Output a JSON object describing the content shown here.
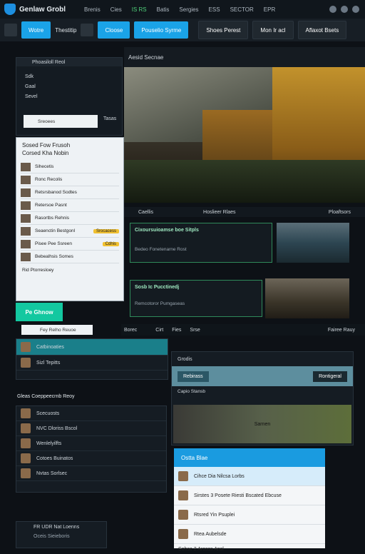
{
  "app": {
    "title": "Genlaw Grobl"
  },
  "menu": [
    "Brenis",
    "Cies",
    "IS RS",
    "Batis",
    "Sergies",
    "ESS",
    "SECTOR",
    "EPR"
  ],
  "toolbar": {
    "btn1": "Wotre",
    "label1": "Thestitip",
    "btn2": "Cloose",
    "btn3": "Pouselio Syrme",
    "field1": "Shoes Perest",
    "field2": "Mon Ir acl",
    "field3": "Aflaxot Bsets"
  },
  "left_panel": {
    "header": "Phoasiloll Reol",
    "items": [
      "Sdk",
      "Gaal",
      "Sevel"
    ],
    "search_label": "Sreoees",
    "search_btn": "Tasas"
  },
  "hero": {
    "caption": "Aesid Secnae"
  },
  "dialog": {
    "title": "Sosed Fow Frusoh",
    "subtitle": "Corsed Kha Nobin",
    "rows": [
      {
        "text": "Sihecetis",
        "btn": ""
      },
      {
        "text": "Ronc Recolis",
        "btn": ""
      },
      {
        "text": "Retsrsbanod Sodtes",
        "btn": ""
      },
      {
        "text": "Retersoe Pasnt",
        "btn": ""
      },
      {
        "text": "Rasortbs Rehnis",
        "btn": ""
      },
      {
        "text": "Seaenctin Bestgonl",
        "btn": "Srocacess"
      },
      {
        "text": "Pisee Pee Ssreen",
        "btn": "Cdhis"
      },
      {
        "text": "Bebealhsis Somes",
        "btn": ""
      }
    ],
    "footer": "Rid Ptorresloey",
    "footer_btn": "Fey Relho Reuoe"
  },
  "teal_button": "Pe Ghnow",
  "mid_bar": {
    "left": "Caellis",
    "center": "Hoslieer Rlaes",
    "right": "Ploaftsors"
  },
  "story1": {
    "title": "Cixoursuioamse boe Sitpls",
    "meta": "Bedeo Fonetenarne Rost"
  },
  "story2": {
    "title": "Sosb Ic Pucctinedj",
    "meta": "Remcotoror Pumgaseas"
  },
  "strip": {
    "items": [
      "Borec",
      "Cirt",
      "Fies",
      "Srse"
    ],
    "right": "Fairee Rauy"
  },
  "list_a": {
    "header": "Catbinoaties",
    "sub": "Sizl Tepitts",
    "rows": [
      "Scecuosts",
      "NVC Dloriss Bscol",
      "Wenlelyilfts",
      "Cotoes Buinatos",
      "Nvtas Sorlsec"
    ],
    "section": "Gleas Coeppeecrnb Reoy"
  },
  "list_b": {
    "title": "Grodis",
    "tabs": [
      "Rebirass",
      "Rontigeral"
    ],
    "meta": "Capio Stansb",
    "image_label": "Sarnen"
  },
  "modal": {
    "header": "Ostta Blae",
    "rows": [
      "Cihce Dia Nilcsa Lorbs",
      "Sirstes 3 Posete Riesti Bscated Ebcuse",
      "Rtsred Yin Psuplei",
      "Rtea Aubelsde",
      "Sohse 2 Arosss Ansl"
    ]
  },
  "bottom": {
    "caption": "FR UDR Nat Loenns",
    "sub": "Oceis Sieieboris"
  },
  "colors": {
    "accent_blue": "#1aa3e8",
    "accent_teal": "#13c8a0",
    "accent_green": "#4fd17a",
    "bg": "#0d1116"
  }
}
